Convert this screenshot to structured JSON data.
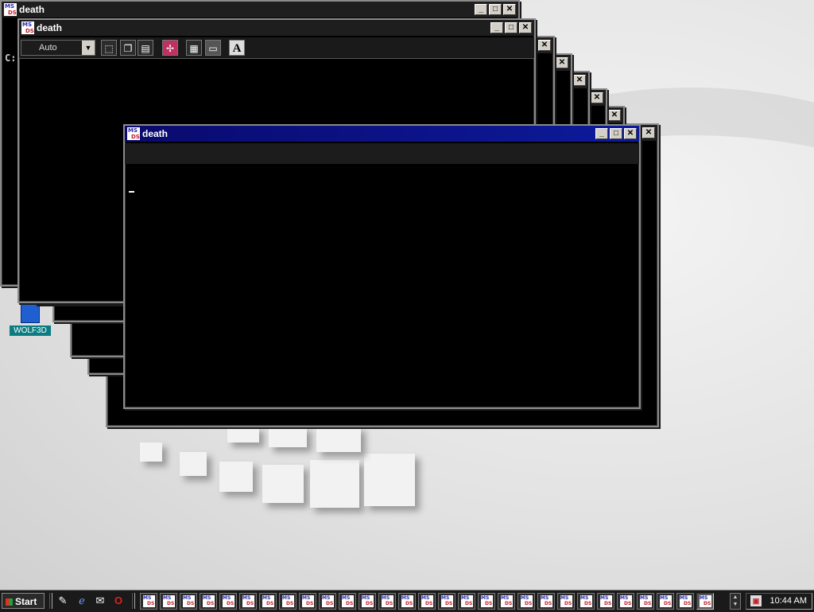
{
  "desktop": {
    "icon_label": "WOLF3D"
  },
  "windows": {
    "back_title": "death",
    "back_prompt": "C:",
    "middle_title": "death",
    "front_title": "death"
  },
  "toolbar": {
    "font_size_value": "Auto",
    "font_button_label": "A"
  },
  "titlebar_controls": {
    "minimize": "_",
    "maximize": "□",
    "close": "✕"
  },
  "taskbar": {
    "start_label": "Start",
    "clock": "10:44 AM",
    "task_button_count": 29
  },
  "colors": {
    "active_title": "#0a0a6e",
    "inactive_title": "#1e1e1e",
    "console_bg": "#000000",
    "icon_label_bg": "#0a7c82"
  }
}
